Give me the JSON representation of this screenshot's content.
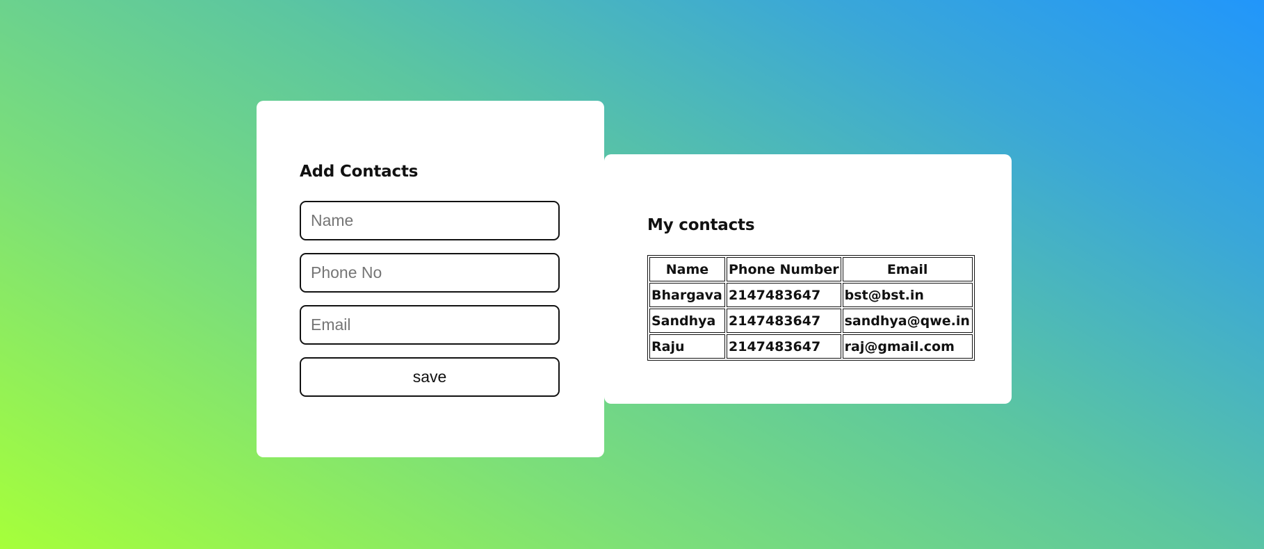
{
  "add_form": {
    "title": "Add Contacts",
    "name_placeholder": "Name",
    "phone_placeholder": "Phone No",
    "email_placeholder": "Email",
    "save_label": "save"
  },
  "contacts": {
    "title": "My contacts",
    "headers": {
      "name": "Name",
      "phone": "Phone Number",
      "email": "Email"
    },
    "rows": [
      {
        "name": "Bhargava",
        "phone": "2147483647",
        "email": "bst@bst.in"
      },
      {
        "name": "Sandhya",
        "phone": "2147483647",
        "email": "sandhya@qwe.in"
      },
      {
        "name": "Raju",
        "phone": "2147483647",
        "email": "raj@gmail.com"
      }
    ]
  },
  "colors": {
    "gradient_start": "#a6ff3a",
    "gradient_end": "#2196fb",
    "card_background": "#ffffff"
  }
}
